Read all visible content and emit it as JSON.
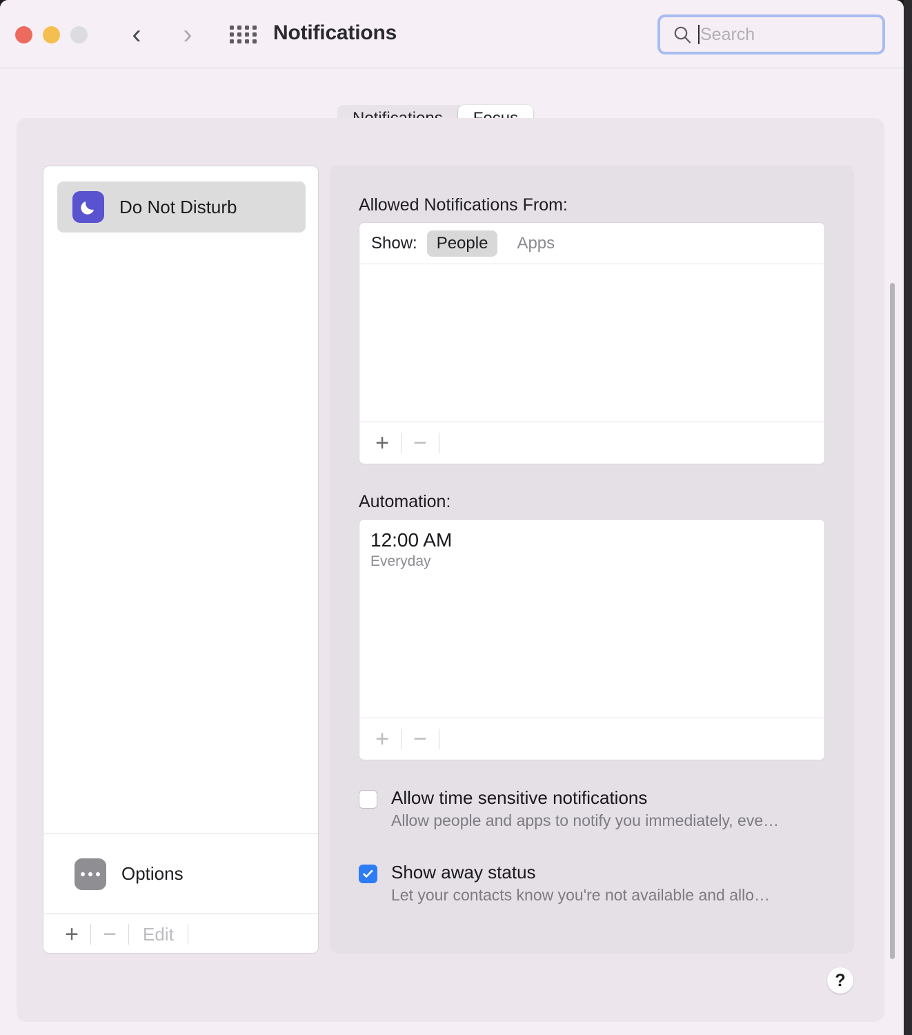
{
  "window": {
    "title": "Notifications",
    "traffic_lights": [
      "close",
      "minimize",
      "zoom"
    ],
    "nav_back_icon": "chevron-left-icon",
    "nav_forward_icon": "chevron-right-icon",
    "grid_icon": "app-grid-icon",
    "colors": {
      "titlebar_bg": "#f6f0f6",
      "content_panel_bg": "#ece6ec",
      "detail_panel_bg": "#e5dfe6",
      "accent_blue": "#2d7cf6",
      "focus_ring": "#a8bdf0",
      "dnd_icon_bg": "#5a53cf",
      "options_icon_bg": "#8e8e93",
      "close_red": "#ec6a5e",
      "minimize_yellow": "#f4bf4f",
      "zoom_gray": "#dcdce0"
    }
  },
  "search": {
    "value": "",
    "placeholder": "Search",
    "icon": "search-icon",
    "focused": true
  },
  "tabs": [
    {
      "label": "Notifications",
      "selected": false
    },
    {
      "label": "Focus",
      "selected": true
    }
  ],
  "sidebar": {
    "focus_modes": [
      {
        "label": "Do Not Disturb",
        "icon": "moon-icon",
        "selected": true
      }
    ],
    "options": {
      "label": "Options",
      "icon": "ellipsis-icon"
    },
    "toolbar": {
      "add_label": "+",
      "remove_label": "−",
      "edit_label": "Edit",
      "add_enabled": true,
      "remove_enabled": false,
      "edit_enabled": false
    }
  },
  "detail": {
    "allowed": {
      "heading": "Allowed Notifications From:",
      "show_label": "Show:",
      "segments": [
        {
          "label": "People",
          "selected": true
        },
        {
          "label": "Apps",
          "selected": false
        }
      ],
      "items": [],
      "toolbar": {
        "add_label": "+",
        "remove_label": "−",
        "add_enabled": true,
        "remove_enabled": false
      }
    },
    "automation": {
      "heading": "Automation:",
      "entries": [
        {
          "time": "12:00 AM",
          "repeat": "Everyday"
        }
      ],
      "toolbar": {
        "add_label": "+",
        "remove_label": "−",
        "add_enabled": false,
        "remove_enabled": false
      }
    },
    "checkboxes": [
      {
        "title": "Allow time sensitive notifications",
        "subtitle": "Allow people and apps to notify you immediately, eve…",
        "checked": false
      },
      {
        "title": "Show away status",
        "subtitle": "Let your contacts know you're not available and allo…",
        "checked": true
      }
    ]
  },
  "help_button": {
    "label": "?",
    "icon": "question-mark-icon"
  }
}
